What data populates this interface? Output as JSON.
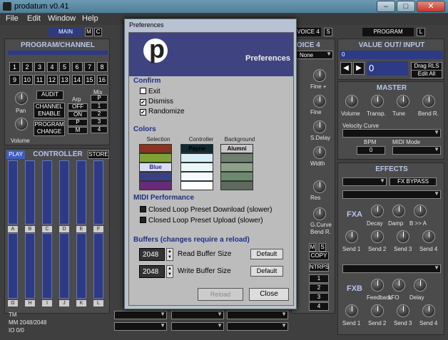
{
  "window": {
    "title": "prodatum v0.41",
    "min": "–",
    "max": "□",
    "close": "✕"
  },
  "menu": [
    "File",
    "Edit",
    "Window",
    "Help"
  ],
  "tabs": {
    "main": "MAIN",
    "m": "M",
    "c": "C",
    "voice": "VOICE 4",
    "s": "S",
    "program": "PROGRAM",
    "l": "L"
  },
  "program_channel": {
    "title": "PROGRAM/CHANNEL",
    "channels": [
      "1",
      "2",
      "3",
      "4",
      "5",
      "6",
      "7",
      "8",
      "9",
      "10",
      "11",
      "12",
      "13",
      "14",
      "15",
      "16"
    ],
    "audit": "AUDIT",
    "channel_enable": "CHANNEL ENABLE",
    "program_change": "PROGRAM CHANGE",
    "arp": "Arp",
    "mix": "Mix",
    "arp_opts": [
      "OFF",
      "ON",
      "P",
      "M"
    ],
    "mix_opts": [
      "P",
      "1",
      "2",
      "3",
      "4"
    ],
    "pan": "Pan",
    "volume": "Volume"
  },
  "controller": {
    "play": "PLAY",
    "title": "CONTROLLER",
    "store": "STORE",
    "faders_top": [
      "A",
      "B",
      "C",
      "D",
      "E",
      "F"
    ],
    "faders_bottom": [
      "G",
      "H",
      "I",
      "J",
      "K",
      "L"
    ],
    "tm": "TM",
    "mm": "MM 2048/2048",
    "io": "IO 0/0"
  },
  "voice": {
    "title": "VOICE 4",
    "name": "None",
    "labels": [
      "Fine +",
      "Fine",
      "S.Delay",
      "Width",
      "Res",
      "G.Curve",
      "Bend R."
    ],
    "ms": [
      "M",
      "S"
    ],
    "copy": "COPY",
    "ntrps": "NTRPS",
    "nums": [
      "1",
      "2",
      "3",
      "4"
    ]
  },
  "value_out": {
    "title": "VALUE OUT/ INPUT",
    "field": "0",
    "value": "0",
    "drag": "Drag RLS",
    "edit": "Edit All"
  },
  "master": {
    "title": "MASTER",
    "knobs": [
      "Volume",
      "Transp.",
      "Tune",
      "Bend R."
    ],
    "velocity": "Velocity Curve",
    "bpm": "BPM",
    "bpm_value": "0",
    "midi_mode": "MIDI Mode"
  },
  "effects": {
    "title": "EFFECTS",
    "bypass": "FX BYPASS",
    "fxa": "FXA",
    "fxa_knobs": [
      "Decay",
      "Damp",
      "B >> A"
    ],
    "sends": [
      "Send 1",
      "Send 2",
      "Send 3",
      "Send 4"
    ],
    "fxb": "FXB",
    "fxb_knobs": [
      "Feedback",
      "LFO",
      "Delay"
    ]
  },
  "dialog": {
    "title": "Preferences",
    "banner": "Preferences",
    "confirm": {
      "title": "Confirm",
      "items": [
        {
          "label": "Exit",
          "checked": false
        },
        {
          "label": "Dismiss",
          "checked": true
        },
        {
          "label": "Randomize",
          "checked": true
        }
      ]
    },
    "colors": {
      "title": "Colors",
      "selection": "Selection",
      "controller": "Controller",
      "background": "Background",
      "sel_label": "Blue",
      "ctrl_label": "Payne",
      "bg_label": "Alumni",
      "sel_swatches": [
        "#8a3320",
        "#7fa03a",
        "#dcdcf0",
        "#3b3f86",
        "#6a2a7a"
      ],
      "ctrl_swatches": [
        "#0e2a33",
        "#d6eef6",
        "#eaf8fb",
        "#f5fbfd",
        "#ffffff"
      ],
      "bg_swatches": [
        "#c8c8c8",
        "#6e7f70",
        "#8da08a",
        "#6b8a6b",
        "#5d6b5e"
      ]
    },
    "midi": {
      "title": "MIDI Performance",
      "items": [
        "Closed Loop Preset Download (slower)",
        "Closed Loop Preset Upload (slower)"
      ]
    },
    "buffers": {
      "title": "Buffers (changes require a reload)",
      "read_value": "2048",
      "read_label": "Read Buffer Size",
      "write_value": "2048",
      "write_label": "Write Buffer Size",
      "default": "Default"
    },
    "reload": "Reload",
    "close": "Close"
  }
}
